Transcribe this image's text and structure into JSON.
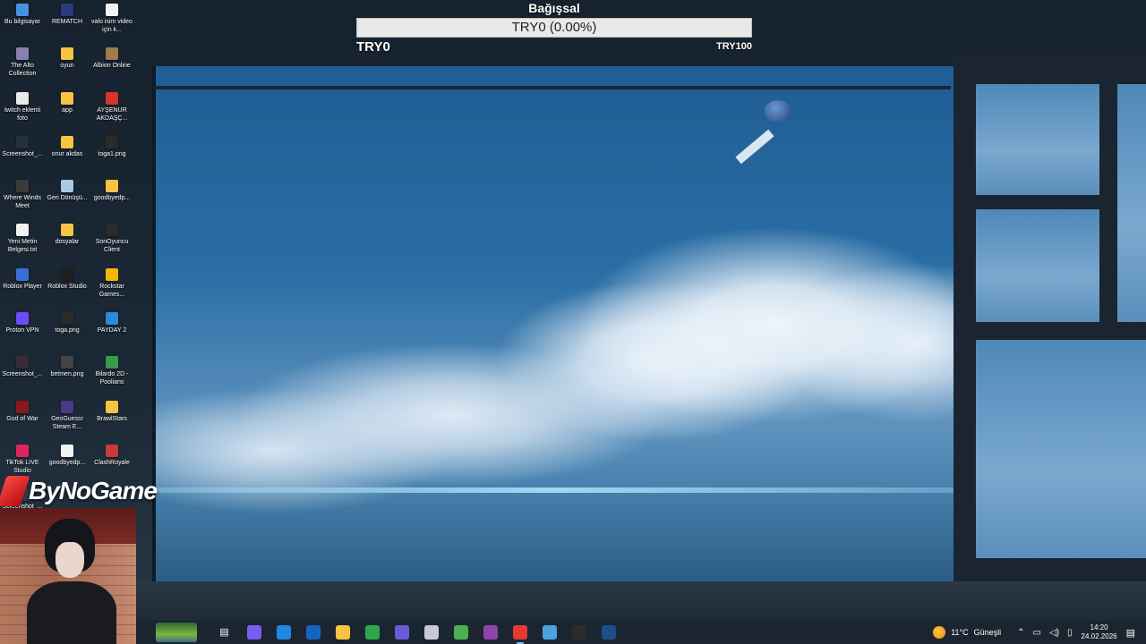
{
  "donation": {
    "title": "Bağışsal",
    "bar_text": "TRY0 (0.00%)",
    "progress_percent": 0,
    "min_label": "TRY0",
    "max_label": "TRY100"
  },
  "desktop_icons": [
    {
      "label": "Bu bilgisayar",
      "icon": "computer-icon",
      "color": "#4a90e2"
    },
    {
      "label": "REMATCH",
      "icon": "game-icon",
      "color": "#2b3a7a"
    },
    {
      "label": "valo isim video için k...",
      "icon": "document-icon",
      "color": "#f2f2f2"
    },
    {
      "label": "The Alto Collection",
      "icon": "game-icon",
      "color": "#8a7fb0"
    },
    {
      "label": "oyun",
      "icon": "folder-icon",
      "color": "#f5c542"
    },
    {
      "label": "Albion Online",
      "icon": "game-icon",
      "color": "#a07a4a"
    },
    {
      "label": "twitch eklenti foto",
      "icon": "document-icon",
      "color": "#e9e9e9"
    },
    {
      "label": "app",
      "icon": "folder-icon",
      "color": "#f5c542"
    },
    {
      "label": "AYŞENUR AKDAŞÇ...",
      "icon": "pdf-icon",
      "color": "#d9342b"
    },
    {
      "label": "Screenshot_...",
      "icon": "image-icon",
      "color": "#233040"
    },
    {
      "label": "onur akdas",
      "icon": "folder-icon",
      "color": "#f5c542"
    },
    {
      "label": "toga1.png",
      "icon": "image-icon",
      "color": "#2a2a2a"
    },
    {
      "label": "Where Winds Meet",
      "icon": "game-icon",
      "color": "#3b3b3b"
    },
    {
      "label": "Geri Dönüşü...",
      "icon": "recycle-bin-icon",
      "color": "#a8c8e8"
    },
    {
      "label": "goodbyedp...",
      "icon": "folder-icon",
      "color": "#f5c542"
    },
    {
      "label": "Yeni Metin Belgesi.txt",
      "icon": "text-file-icon",
      "color": "#f2f2f2"
    },
    {
      "label": "dosyalar",
      "icon": "folder-icon",
      "color": "#f5c542"
    },
    {
      "label": "SonOyuncu Client",
      "icon": "game-icon",
      "color": "#2a2a2a"
    },
    {
      "label": "Roblox Player",
      "icon": "roblox-icon",
      "color": "#3b6fd4"
    },
    {
      "label": "Roblox Studio",
      "icon": "roblox-studio-icon",
      "color": "#1f1f1f"
    },
    {
      "label": "Rockstar Games...",
      "icon": "rockstar-icon",
      "color": "#f5b800"
    },
    {
      "label": "Proton VPN",
      "icon": "vpn-icon",
      "color": "#6d4aff"
    },
    {
      "label": "toga.png",
      "icon": "image-icon",
      "color": "#2a2a2a"
    },
    {
      "label": "PAYDAY 2",
      "icon": "game-icon",
      "color": "#2a8ad8"
    },
    {
      "label": "Screenshot_...",
      "icon": "image-icon",
      "color": "#3a2a3a"
    },
    {
      "label": "betmen.png",
      "icon": "image-icon",
      "color": "#444444"
    },
    {
      "label": "Bilardo 2D - Poolians",
      "icon": "game-icon",
      "color": "#3a9a4a"
    },
    {
      "label": "God of War",
      "icon": "game-icon",
      "color": "#8a1a1a"
    },
    {
      "label": "GeoGuessr Steam E...",
      "icon": "game-icon",
      "color": "#4a3a8a"
    },
    {
      "label": "BrawlStars",
      "icon": "game-icon",
      "color": "#f5c542"
    },
    {
      "label": "TikTok LIVE Studio",
      "icon": "tiktok-icon",
      "color": "#e0245e"
    },
    {
      "label": "goodbyedp...",
      "icon": "document-icon",
      "color": "#f2f2f2"
    },
    {
      "label": "ClashRoyale",
      "icon": "game-icon",
      "color": "#c83a3a"
    },
    {
      "label": "Screenshot_...",
      "icon": "image-icon",
      "color": "#2a3a4a"
    }
  ],
  "overlay": {
    "brand_text": "ByNoGame"
  },
  "taskbar": {
    "apps": [
      {
        "name": "task-view",
        "icon": "task-view-icon",
        "glyph": "▤",
        "color": "transparent"
      },
      {
        "name": "copilot",
        "icon": "copilot-icon",
        "glyph": "",
        "color": "#7b5cf0"
      },
      {
        "name": "edge",
        "icon": "edge-icon",
        "glyph": "",
        "color": "#1e88e5"
      },
      {
        "name": "outlook",
        "icon": "outlook-icon",
        "glyph": "",
        "color": "#1565c0"
      },
      {
        "name": "file-explorer",
        "icon": "folder-icon",
        "glyph": "",
        "color": "#f5c542"
      },
      {
        "name": "store",
        "icon": "store-icon",
        "glyph": "",
        "color": "#2ba84a"
      },
      {
        "name": "discord",
        "icon": "discord-icon",
        "glyph": "",
        "color": "#6b5bdc"
      },
      {
        "name": "app-icon",
        "icon": "app-icon",
        "glyph": "",
        "color": "#c8c8d8"
      },
      {
        "name": "notepad-plus",
        "icon": "notepad-icon",
        "glyph": "",
        "color": "#4caf50"
      },
      {
        "name": "obs-like",
        "icon": "clapper-icon",
        "glyph": "",
        "color": "#8e44ad"
      },
      {
        "name": "opera",
        "icon": "opera-icon",
        "glyph": "",
        "color": "#e53935",
        "active": true
      },
      {
        "name": "bluestacks",
        "icon": "game-launcher-icon",
        "glyph": "",
        "color": "#4aa3df"
      },
      {
        "name": "obs",
        "icon": "obs-icon",
        "glyph": "",
        "color": "#2b2b2b"
      },
      {
        "name": "steam",
        "icon": "steam-icon",
        "glyph": "",
        "color": "#1b4f8a"
      }
    ],
    "weather": {
      "temp": "11°C",
      "condition": "Güneşli"
    },
    "clock": {
      "time": "14:20",
      "date": "24.02.2026"
    }
  }
}
